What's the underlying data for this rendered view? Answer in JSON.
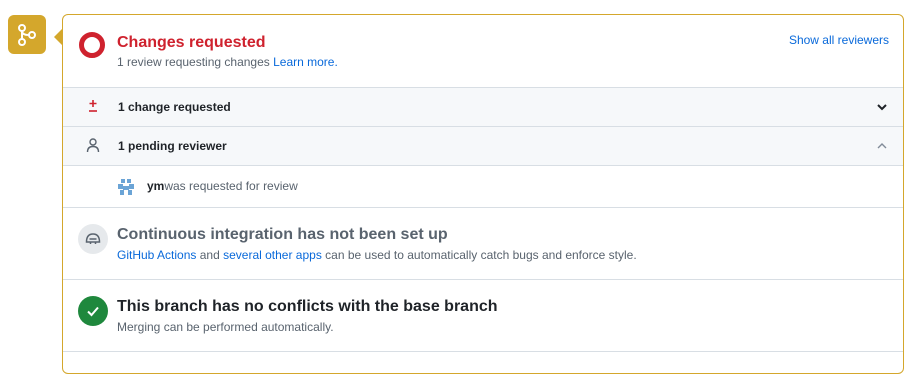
{
  "status": {
    "title": "Changes requested",
    "subtitle": "1 review requesting changes",
    "learn_more": "Learn more.",
    "show_all": "Show all reviewers",
    "color": "#cf222e"
  },
  "changes_row": {
    "label": "1 change requested",
    "icon": "diff-icon",
    "expanded": false
  },
  "pending_row": {
    "label": "1 pending reviewer",
    "icon": "person-icon",
    "expanded": true
  },
  "reviewer": {
    "name": "ym",
    "text": "was requested for review"
  },
  "ci": {
    "title": "Continuous integration has not been set up",
    "link1": "GitHub Actions",
    "and": "and",
    "link2": "several other apps",
    "rest": "can be used to automatically catch bugs and enforce style."
  },
  "conflicts": {
    "title": "This branch has no conflicts with the base branch",
    "subtitle": "Merging can be performed automatically.",
    "color": "#1f883d"
  },
  "colors": {
    "accent": "#d4a72c",
    "link": "#0969da",
    "danger": "#cf222e",
    "success": "#1f883d"
  }
}
